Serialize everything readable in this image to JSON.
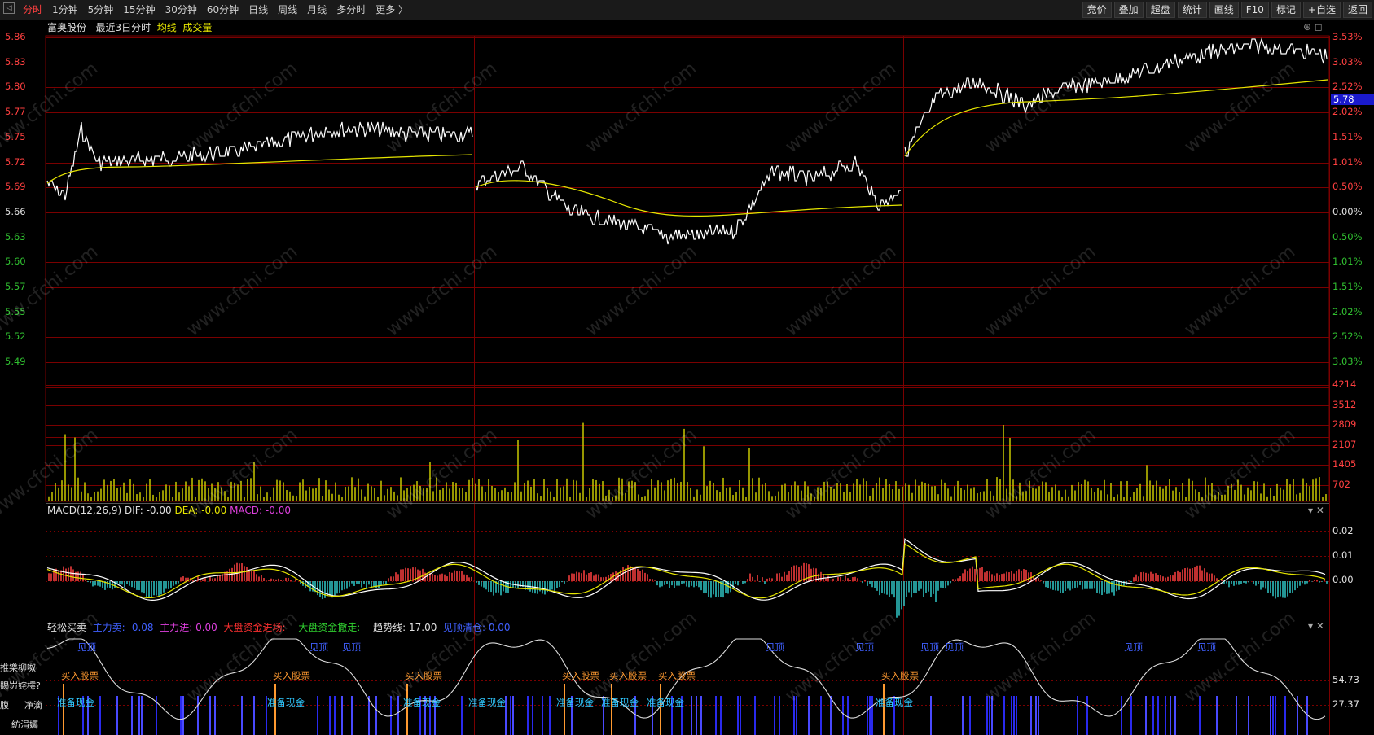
{
  "toolbar": {
    "tabs": [
      "分时",
      "1分钟",
      "5分钟",
      "15分钟",
      "30分钟",
      "60分钟",
      "日线",
      "周线",
      "月线",
      "多分时",
      "更多 〉"
    ],
    "active_tab": "分时",
    "right_buttons": [
      "竞价",
      "叠加",
      "超盘",
      "统计",
      "画线",
      "F10",
      "标记",
      "+自选",
      "返回"
    ]
  },
  "main_panel": {
    "stock_name": "富奥股份",
    "period_label": "最近3日分时",
    "avg_label": "均线",
    "volume_label": "成交量",
    "price_ticks": [
      "5.86",
      "5.83",
      "5.80",
      "5.77",
      "5.75",
      "5.72",
      "5.69",
      "5.66",
      "5.63",
      "5.60",
      "5.57",
      "5.55",
      "5.52",
      "5.49"
    ],
    "pct_ticks": [
      "3.53%",
      "3.03%",
      "2.52%",
      "2.02%",
      "1.51%",
      "1.01%",
      "0.50%",
      "0.00%",
      "0.50%",
      "1.01%",
      "1.51%",
      "2.02%",
      "2.52%",
      "3.03%"
    ],
    "current_price": "5.78",
    "volume_ticks": [
      "4214",
      "3512",
      "2809",
      "2107",
      "1405",
      "702"
    ]
  },
  "macd_panel": {
    "title": "MACD(12,26,9)",
    "dif_label": "DIF:",
    "dif_value": "-0.00",
    "dea_label": "DEA:",
    "dea_value": "-0.00",
    "macd_label": "MACD:",
    "macd_value": "-0.00",
    "ticks": [
      "0.02",
      "0.01",
      "0.00"
    ]
  },
  "easy_panel": {
    "title": "轻松买卖",
    "main_sell": "主力卖: -0.08",
    "main_buy": "主力进: 0.00",
    "market_in": "大盘资金进场: -",
    "market_out": "大盘资金撤走: -",
    "trend": "趋势线: 17.00",
    "top_clear": "见顶清仓: 0.00",
    "ticks": [
      "54.73",
      "27.37"
    ],
    "buy_signals": [
      "买入股票",
      "买入股票",
      "买入股票",
      "买入股票",
      "买入股票",
      "买入股票",
      "买入股票"
    ],
    "cash_signals": [
      "准备现金",
      "准备现金",
      "准备现金",
      "准备现金",
      "准备现金",
      "准备现金",
      "准备现金",
      "准备现金"
    ],
    "left_cut_labels": [
      "推樂柳呶",
      "賜岃姹樗?",
      "腹",
      "净滴",
      "紡涓孎"
    ]
  },
  "watermark": "www.cfchi.com",
  "colors": {
    "price_line": "#ffffff",
    "avg_line": "#e6e600",
    "volume_bar": "#c8c800",
    "grid": "#7a0000",
    "up": "#ff4040",
    "down": "#30c030",
    "macd_up": "#ff4040",
    "macd_down": "#30c8c8"
  }
}
